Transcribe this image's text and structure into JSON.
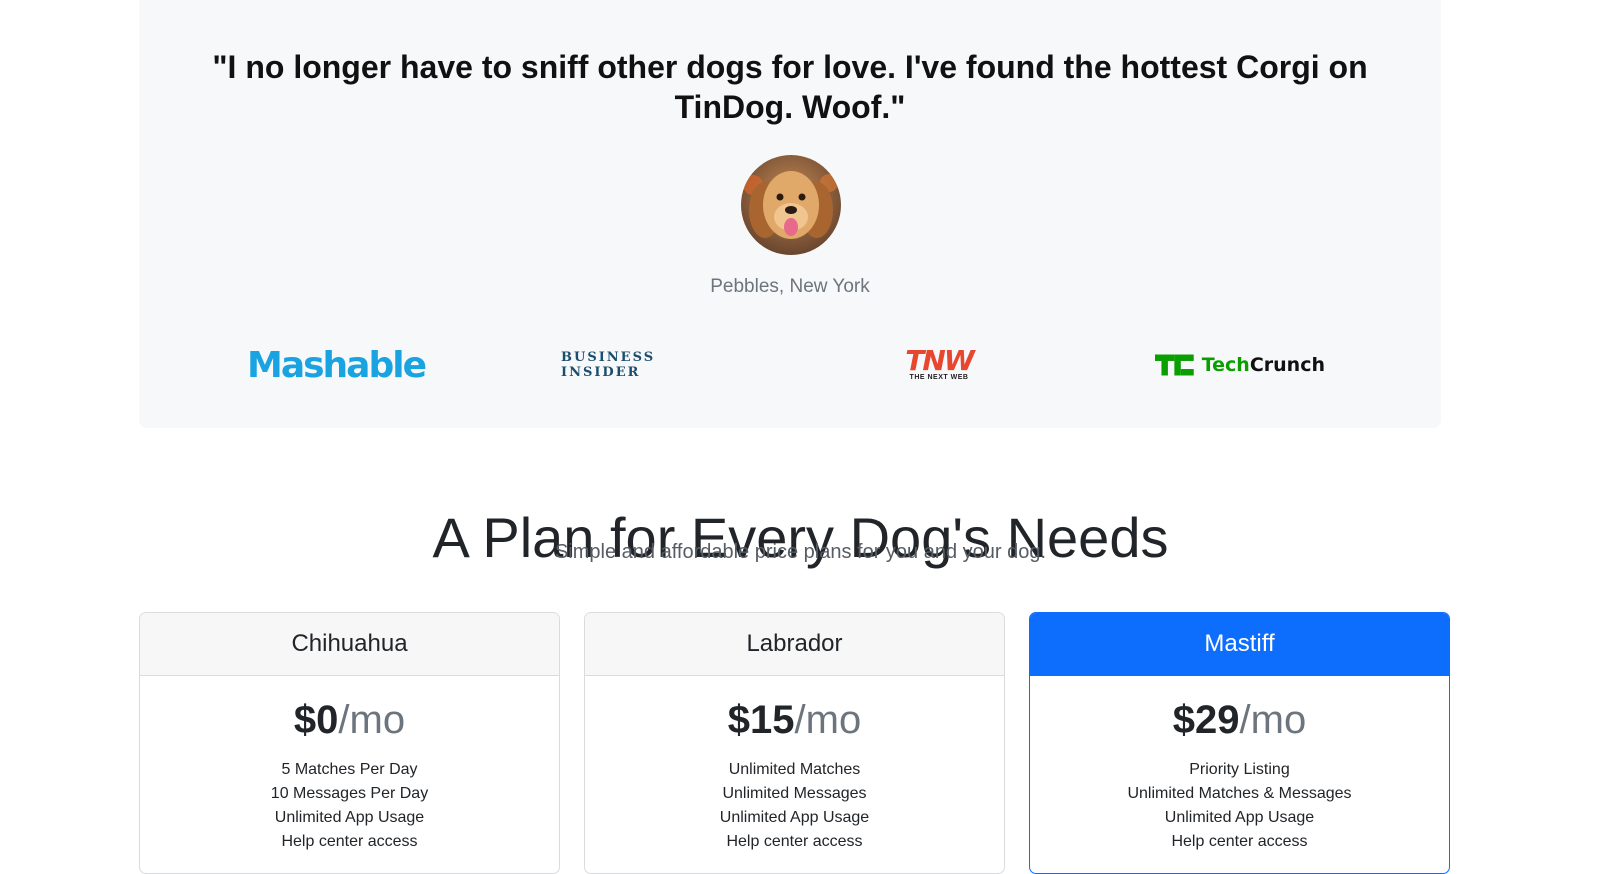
{
  "testimonial": {
    "quote_line1": "\"I no longer have to sniff other dogs for love. I've found the hottest Corgi on",
    "quote_line2": "TinDog. Woof.\"",
    "author": "Pebbles, New York"
  },
  "press": {
    "mashable": "Mashable",
    "business_insider": "BUSINESS INSIDER",
    "tnw": "TNW",
    "tnw_sub": "THE NEXT WEB",
    "techcrunch_a": "Tech",
    "techcrunch_b": "Crunch"
  },
  "pricing": {
    "title": "A Plan for Every Dog's Needs",
    "subtitle": "Simple and affordable price plans for you and your dog.",
    "plans": [
      {
        "name": "Chihuahua",
        "price": "$0",
        "period": "/mo",
        "features": [
          "5 Matches Per Day",
          "10 Messages Per Day",
          "Unlimited App Usage",
          "Help center access"
        ]
      },
      {
        "name": "Labrador",
        "price": "$15",
        "period": "/mo",
        "features": [
          "Unlimited Matches",
          "Unlimited Messages",
          "Unlimited App Usage",
          "Help center access"
        ]
      },
      {
        "name": "Mastiff",
        "price": "$29",
        "period": "/mo",
        "features": [
          "Priority Listing",
          "Unlimited Matches & Messages",
          "Unlimited App Usage",
          "Help center access"
        ]
      }
    ]
  },
  "colors": {
    "primary": "#0d6efd",
    "mashable": "#19a3e0",
    "tnw": "#e8472f",
    "techcrunch": "#0a9e01"
  }
}
